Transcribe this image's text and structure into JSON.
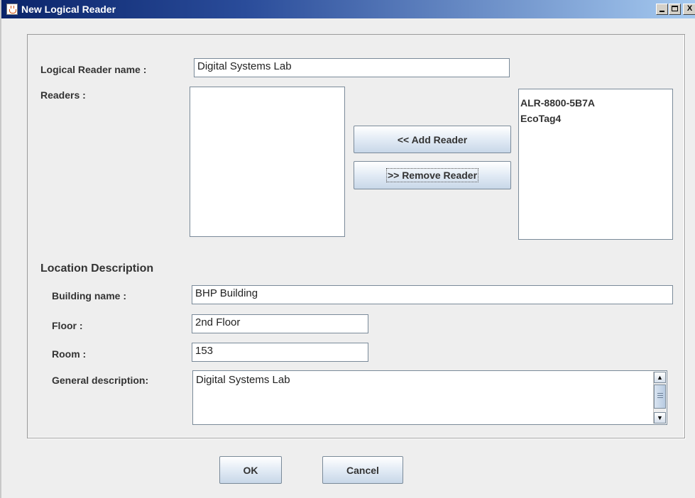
{
  "window": {
    "title": "New Logical Reader",
    "controls": {
      "minimize": "_",
      "maximize": "□",
      "close": "X"
    }
  },
  "form": {
    "logical_reader_name_label": "Logical Reader name :",
    "logical_reader_name_value": "Digital Systems Lab",
    "readers_label": "Readers :",
    "available_readers": [],
    "selected_readers": [
      "ALR-8800-5B7A",
      "EcoTag4"
    ],
    "add_reader_button": "<< Add Reader",
    "remove_reader_button": ">> Remove Reader"
  },
  "location": {
    "section_title": "Location Description",
    "building_label": "Building name :",
    "building_value": "BHP Building",
    "floor_label": "Floor :",
    "floor_value": "2nd Floor",
    "room_label": "Room :",
    "room_value": "153",
    "general_label": "General description:",
    "general_value": "Digital Systems Lab"
  },
  "actions": {
    "ok": "OK",
    "cancel": "Cancel"
  },
  "icons": {
    "title_icon": "java-cup-icon",
    "scroll_up": "scroll-up-arrow-icon",
    "scroll_down": "scroll-down-arrow-icon"
  }
}
